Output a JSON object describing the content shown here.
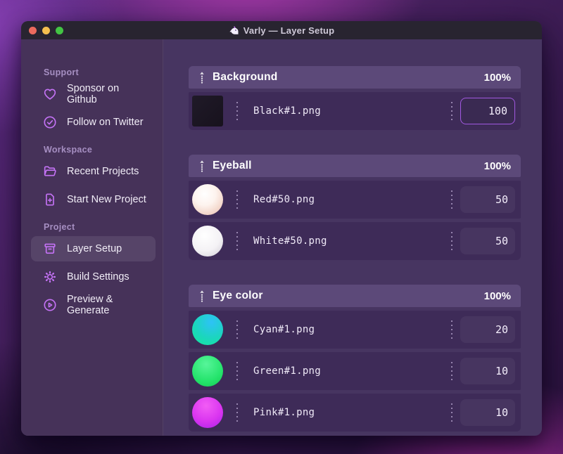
{
  "window": {
    "title": "Varly — Layer Setup",
    "app_icon": "unicorn-icon"
  },
  "colors": {
    "accent": "#c472f5",
    "titlebar_bg": "#282430",
    "sidebar_bg": "#463259",
    "main_bg": "#473561",
    "header_bg": "#5c4979",
    "row_bg": "#3e2b58",
    "focus_border": "#a158e0",
    "muted_label": "#a68fc2",
    "traffic_red": "#ec6a5e",
    "traffic_yellow": "#f4bf4f",
    "traffic_green": "#43c444"
  },
  "sidebar": {
    "sections": [
      {
        "label": "Support",
        "items": [
          {
            "icon": "heart-icon",
            "label": "Sponsor on Github"
          },
          {
            "icon": "check-circle-icon",
            "label": "Follow on Twitter"
          }
        ]
      },
      {
        "label": "Workspace",
        "items": [
          {
            "icon": "folder-icon",
            "label": "Recent Projects"
          },
          {
            "icon": "document-plus-icon",
            "label": "Start New Project"
          }
        ]
      },
      {
        "label": "Project",
        "items": [
          {
            "icon": "archive-box-icon",
            "label": "Layer Setup",
            "selected": true
          },
          {
            "icon": "gear-icon",
            "label": "Build Settings"
          },
          {
            "icon": "play-circle-icon",
            "label": "Preview & Generate"
          }
        ]
      }
    ]
  },
  "layers": {
    "groups": [
      {
        "name": "Background",
        "weight": "100%",
        "items": [
          {
            "thumb": "black-square",
            "file": "Black#1.png",
            "value": "100",
            "focused": true
          }
        ]
      },
      {
        "name": "Eyeball",
        "weight": "100%",
        "items": [
          {
            "thumb": "red-sphere",
            "file": "Red#50.png",
            "value": "50"
          },
          {
            "thumb": "white-sphere",
            "file": "White#50.png",
            "value": "50"
          }
        ]
      },
      {
        "name": "Eye color",
        "weight": "100%",
        "items": [
          {
            "thumb": "cyan-sphere",
            "file": "Cyan#1.png",
            "value": "20"
          },
          {
            "thumb": "green-sphere",
            "file": "Green#1.png",
            "value": "10"
          },
          {
            "thumb": "pink-sphere",
            "file": "Pink#1.png",
            "value": "10"
          }
        ]
      }
    ]
  }
}
